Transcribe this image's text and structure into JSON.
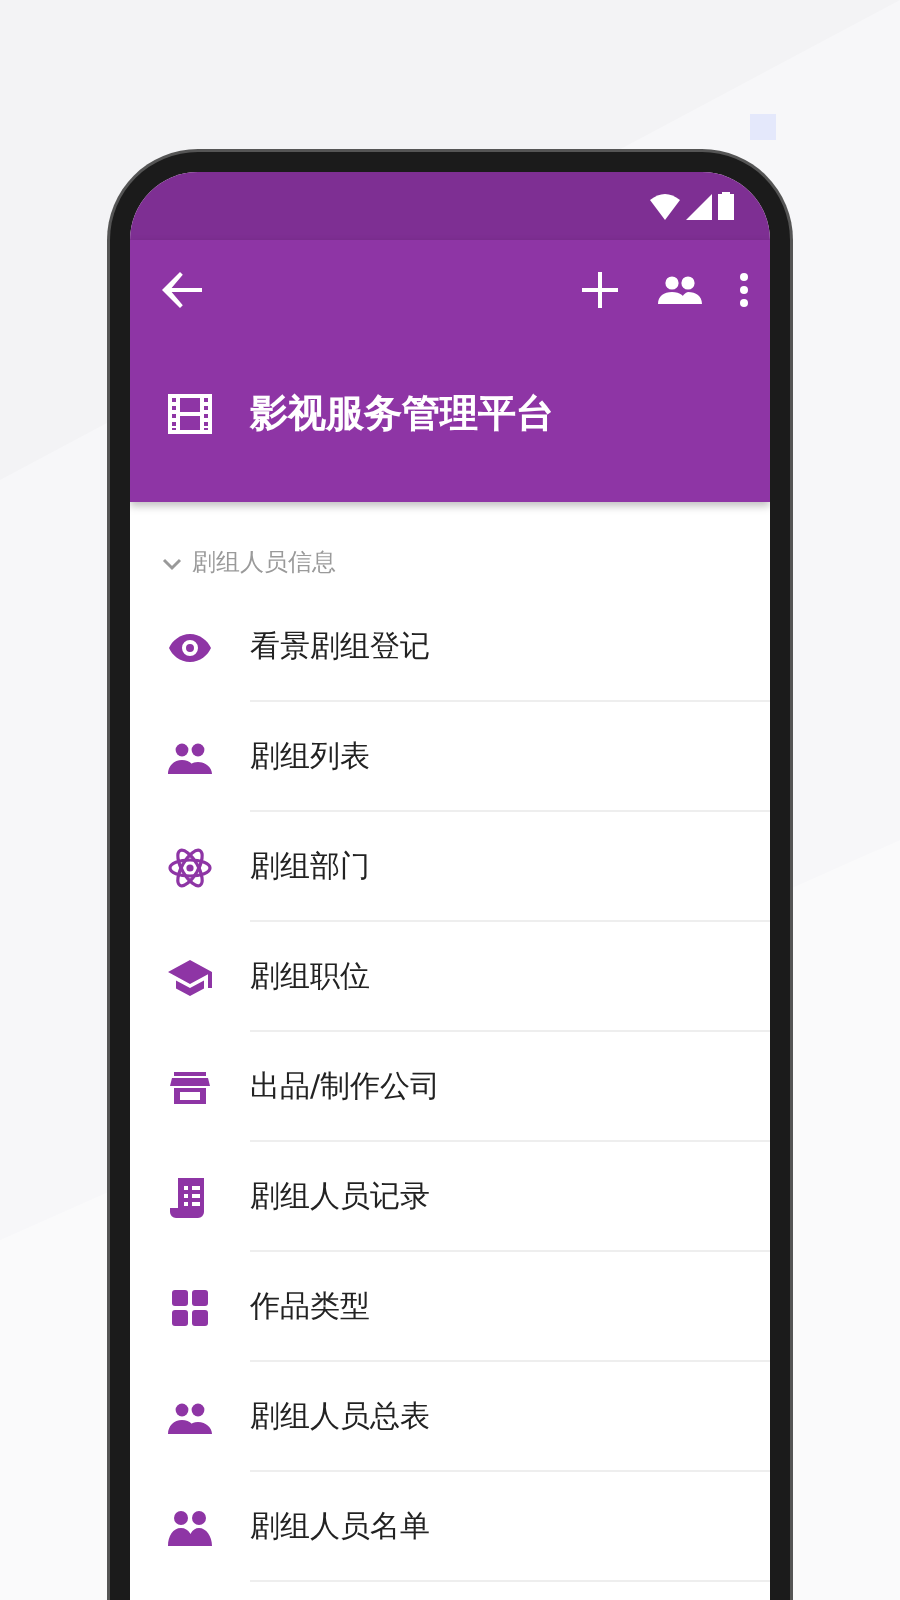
{
  "app_bar": {
    "title": "影视服务管理平台"
  },
  "section": {
    "title": "剧组人员信息",
    "expanded": true
  },
  "menu_items": [
    {
      "kind": "eye",
      "label": "看景剧组登记"
    },
    {
      "kind": "group",
      "label": "剧组列表"
    },
    {
      "kind": "atom",
      "label": "剧组部门"
    },
    {
      "kind": "cap",
      "label": "剧组职位"
    },
    {
      "kind": "store",
      "label": "出品/制作公司"
    },
    {
      "kind": "document",
      "label": "剧组人员记录"
    },
    {
      "kind": "grid",
      "label": "作品类型"
    },
    {
      "kind": "group",
      "label": "剧组人员总表"
    },
    {
      "kind": "pair",
      "label": "剧组人员名单"
    }
  ]
}
